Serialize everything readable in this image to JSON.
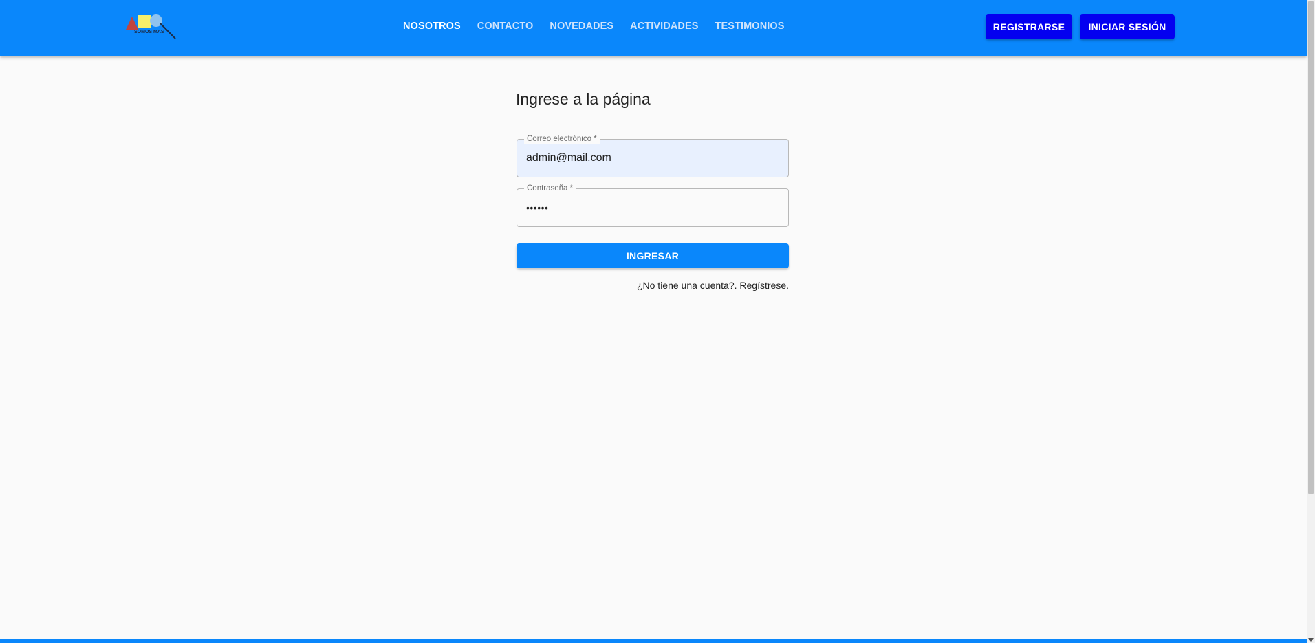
{
  "header": {
    "logo_text": "SOMOS MAS",
    "nav": [
      {
        "label": "NOSOTROS",
        "active": true
      },
      {
        "label": "CONTACTO"
      },
      {
        "label": "NOVEDADES"
      },
      {
        "label": "ACTIVIDADES"
      },
      {
        "label": "TESTIMONIOS"
      }
    ],
    "register_label": "REGISTRARSE",
    "login_label": "INICIAR SESIÓN"
  },
  "form": {
    "title": "Ingrese a la página",
    "email": {
      "label": "Correo electrónico *",
      "value": "admin@mail.com"
    },
    "password": {
      "label": "Contraseña *",
      "value": "••••••"
    },
    "submit_label": "INGRESAR",
    "register_link": "¿No tiene una cuenta?. Regístrese."
  },
  "colors": {
    "header_bg": "#0a87fb",
    "header_button_bg": "#0400f0",
    "primary_button_bg": "#0a87fb",
    "email_field_bg": "#e8f0fe",
    "page_bg": "#fafafa"
  },
  "icons": {
    "logo": "somos-mas-logo",
    "scroll_down": "scroll-down-arrow-icon"
  }
}
